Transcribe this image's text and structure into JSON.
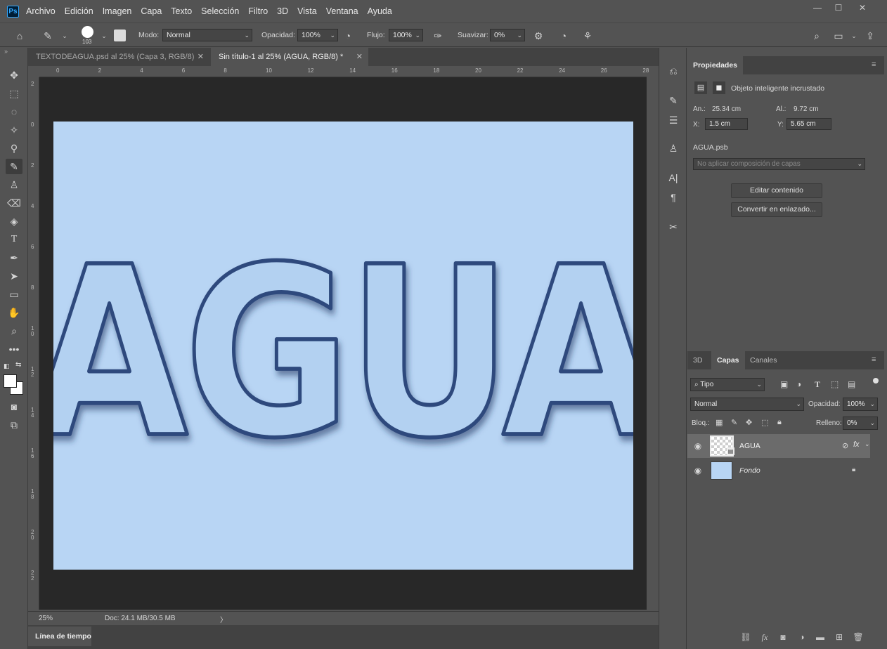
{
  "app": {
    "logo": "Ps"
  },
  "menu": [
    "Archivo",
    "Edición",
    "Imagen",
    "Capa",
    "Texto",
    "Selección",
    "Filtro",
    "3D",
    "Vista",
    "Ventana",
    "Ayuda"
  ],
  "window_controls": [
    "—",
    "☐",
    "✕"
  ],
  "options": {
    "brush_size": "103",
    "mode_label": "Modo:",
    "mode_value": "Normal",
    "opacity_label": "Opacidad:",
    "opacity_value": "100%",
    "flow_label": "Flujo:",
    "flow_value": "100%",
    "smooth_label": "Suavizar:",
    "smooth_value": "0%"
  },
  "tabs": [
    {
      "label": "TEXTODEAGUA.psd al 25% (Capa 3, RGB/8)"
    },
    {
      "label": "Sin título-1 al 25% (AGUA, RGB/8) *"
    }
  ],
  "ruler_top": [
    "0",
    "2",
    "4",
    "6",
    "8",
    "10",
    "12",
    "14",
    "16",
    "18",
    "20",
    "22",
    "24",
    "26",
    "28"
  ],
  "ruler_left": [
    "2",
    "0",
    "2",
    "4",
    "6",
    "8",
    "1 0",
    "1 2",
    "1 4",
    "1 6",
    "1 8",
    "2 0",
    "2 2"
  ],
  "canvas": {
    "text": "AGUA",
    "bg_color": "#b8d5f4",
    "text_color": "#b3d1f1",
    "shadow_color": "#243a66"
  },
  "status": {
    "zoom": "25%",
    "doc": "Doc: 24.1 MB/30.5 MB",
    "arrow": "〉"
  },
  "timeline": {
    "label": "Línea de tiempo"
  },
  "properties": {
    "tab": "Propiedades",
    "type_label": "Objeto inteligente incrustado",
    "w_label": "An.:",
    "w_value": "25.34 cm",
    "h_label": "Al.:",
    "h_value": "9.72 cm",
    "x_label": "X:",
    "x_value": "1.5 cm",
    "y_label": "Y:",
    "y_value": "5.65 cm",
    "file": "AGUA.psb",
    "comp_placeholder": "No aplicar composición de capas",
    "edit_button": "Editar contenido",
    "convert_button": "Convertir en enlazado..."
  },
  "layers_panel": {
    "tabs": [
      "3D",
      "Capas",
      "Canales"
    ],
    "active_tab": "Capas",
    "filter_value": "Tipo",
    "blend_mode": "Normal",
    "opacity_label": "Opacidad:",
    "opacity_value": "100%",
    "lock_label": "Bloq.:",
    "fill_label": "Relleno:",
    "fill_value": "0%",
    "layers": [
      {
        "name": "AGUA",
        "fx": "fx"
      },
      {
        "name": "Fondo"
      }
    ]
  }
}
